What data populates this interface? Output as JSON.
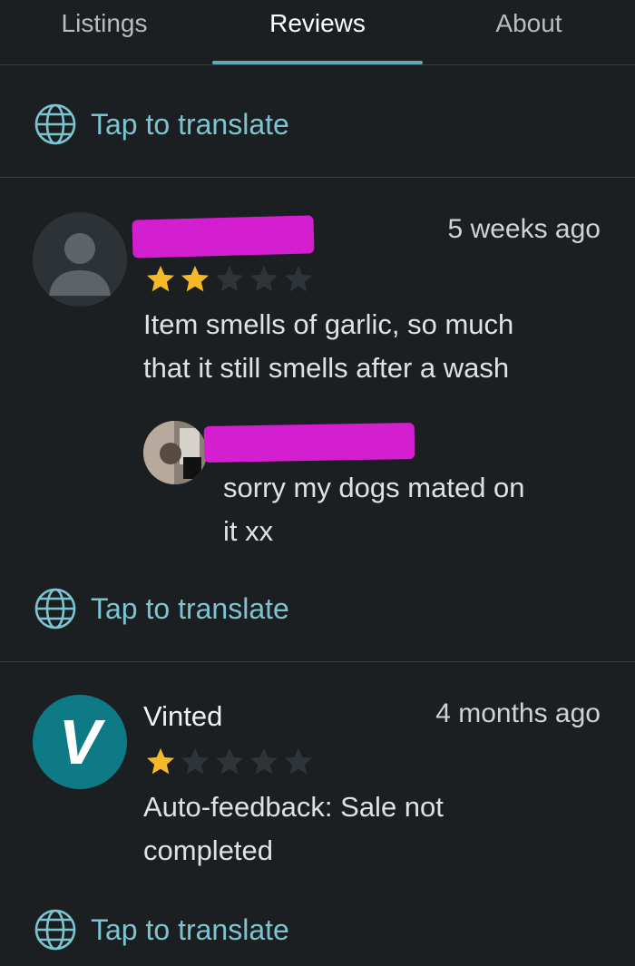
{
  "tabs": [
    {
      "label": "Listings"
    },
    {
      "label": "Reviews"
    },
    {
      "label": "About"
    }
  ],
  "translate_label": "Tap to translate",
  "reviews": [
    {
      "time": "5 weeks ago",
      "rating": 2,
      "text_line1": "Item smells of garlic, so much",
      "text_line2": "that it still smells after a wash",
      "reply": {
        "text_line1": "sorry my dogs mated on",
        "text_line2": "it xx"
      }
    },
    {
      "name": "Vinted",
      "time": "4 months ago",
      "rating": 1,
      "text_line1": "Auto-feedback: Sale not",
      "text_line2": "completed",
      "avatar_letter": "V"
    }
  ],
  "colors": {
    "background": "#1b1f22",
    "accent": "#7cc4cf",
    "star_filled": "#f5b829",
    "star_empty": "#2f3438",
    "redaction": "#d41fd0",
    "vinted_teal": "#0e7a85"
  },
  "icons": [
    "globe-icon",
    "user-silhouette-icon",
    "star-icon"
  ]
}
